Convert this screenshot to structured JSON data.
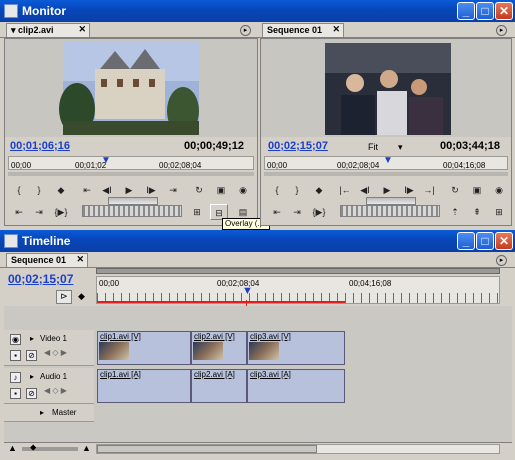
{
  "monitor": {
    "title": "Monitor",
    "source_tab": "clip2.avi",
    "program_tab": "Sequence 01",
    "source": {
      "current_tc": "00;01;06;16",
      "duration_tc": "00;00;49;12",
      "ruler": [
        "00;00",
        "00;01;02",
        "00;02;08;04"
      ]
    },
    "program": {
      "current_tc": "00;02;15;07",
      "fit_label": "Fit",
      "duration_tc": "00;03;44;18",
      "ruler": [
        "00;00",
        "00;02;08;04",
        "00;04;16;08"
      ]
    },
    "tooltip": "Overlay (.)"
  },
  "timeline": {
    "title": "Timeline",
    "tab": "Sequence 01",
    "current_tc": "00;02;15;07",
    "ruler": [
      "00;00",
      "00;02;08;04",
      "00;04;16;08"
    ],
    "tracks": {
      "video_label": "Video 1",
      "audio_label": "Audio 1",
      "master_label": "Master"
    },
    "video_clips": [
      "clip1.avi [V]",
      "clip2.avi [V]",
      "clip3.avi [V]"
    ],
    "audio_clips": [
      "clip1.avi [A]",
      "clip2.avi [A]",
      "clip3.avi [A]"
    ]
  },
  "colors": {
    "title_blue": "#0846b8",
    "timecode_blue": "#1c3fc8",
    "playhead_red": "#e02020"
  }
}
